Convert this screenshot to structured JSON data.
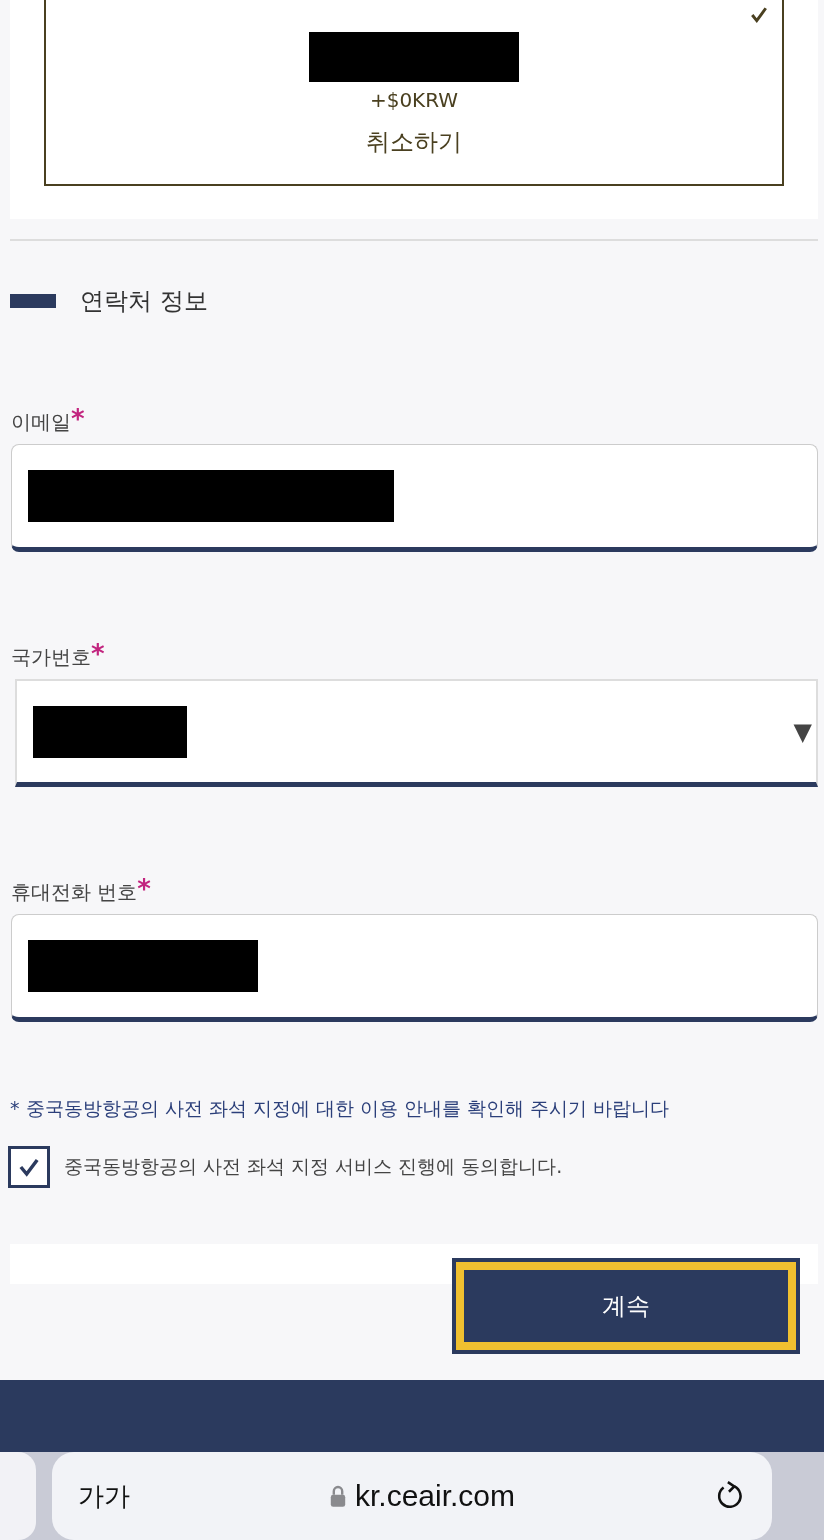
{
  "seat_option": {
    "selected": true,
    "price": "+$0KRW",
    "cancel_label": "취소하기"
  },
  "contact_section": {
    "title": "연락처 정보"
  },
  "fields": [
    {
      "kind": "input",
      "label": "이메일",
      "required_mark": "*"
    },
    {
      "kind": "select",
      "label": "국가번호",
      "required_mark": "*",
      "arrow": "▼"
    },
    {
      "kind": "input",
      "label": "휴대전화 번호",
      "required_mark": "*"
    }
  ],
  "notice": "* 중국동방항공의 사전 좌석 지정에 대한 이용 안내를 확인해 주시기 바랍니다",
  "agreement": {
    "checked": true,
    "label": "중국동방항공의 사전 좌석 지정 서비스 진행에 동의합니다."
  },
  "continue_button": "계속",
  "browser_bar": {
    "text_size": "가가",
    "url": "kr.ceair.com"
  }
}
